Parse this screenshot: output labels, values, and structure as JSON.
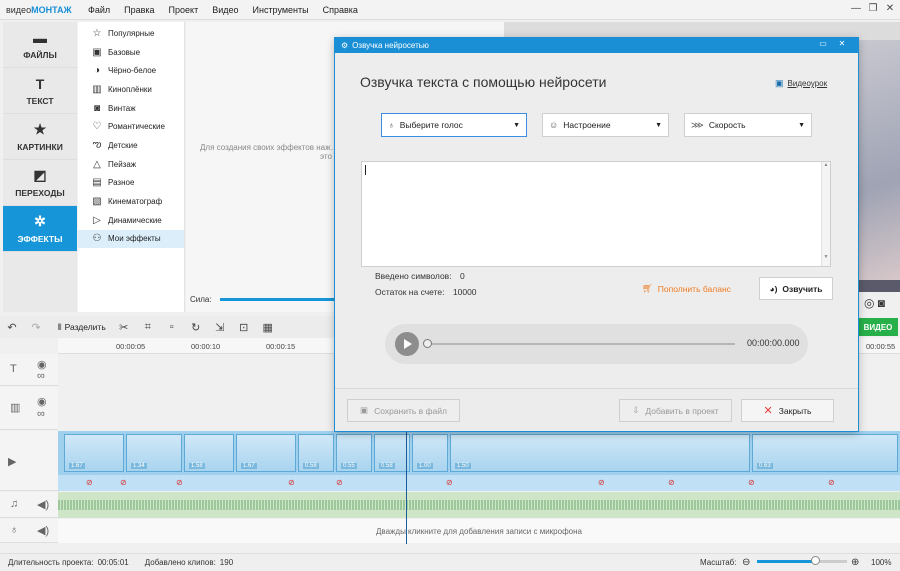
{
  "app": {
    "logo_plain": "видео",
    "logo_accent": "МОНТАЖ"
  },
  "menu": [
    "Файл",
    "Правка",
    "Проект",
    "Видео",
    "Инструменты",
    "Справка"
  ],
  "categories": [
    {
      "label": "ФАЙЛЫ",
      "icon": "folder-icon"
    },
    {
      "label": "ТЕКСТ",
      "icon": "text-icon"
    },
    {
      "label": "КАРТИНКИ",
      "icon": "star-icon"
    },
    {
      "label": "ПЕРЕХОДЫ",
      "icon": "transitions-icon"
    },
    {
      "label": "ЭФФЕКТЫ",
      "icon": "effects-icon"
    }
  ],
  "effects": [
    "Популярные",
    "Базовые",
    "Чёрно-белое",
    "Киноплёнки",
    "Винтаж",
    "Романтические",
    "Детские",
    "Пейзаж",
    "Разное",
    "Кинематограф",
    "Динамические",
    "Мои эффекты"
  ],
  "preview": {
    "hint": "Для создания своих эффектов наж…",
    "hint2": "это",
    "strength_label": "Сила:",
    "export_label": "ВИДЕО"
  },
  "toolbar": {
    "split_label": "Разделить"
  },
  "ruler": [
    "00:00:05",
    "00:00:10",
    "00:00:15",
    "00:00:55"
  ],
  "clip_labels": [
    "1.67",
    "1.34",
    "1.58",
    "1.67",
    "0.58",
    "0.55",
    "0.58",
    "1.00",
    "1.50",
    "0.63"
  ],
  "mic_hint": "Дважды кликните для добавления записи с микрофона",
  "status": {
    "duration_label": "Длительность проекта:",
    "duration": "00:05:01",
    "clips_label": "Добавлено клипов:",
    "clips": "190",
    "zoom_label": "Масштаб:",
    "zoom": "100%"
  },
  "dialog": {
    "window_title": "Озвучка нейросетью",
    "heading": "Озвучка текста с помощью нейросети",
    "tutorial": "Видеоурок",
    "voice_select": "Выберите голос",
    "mood_select": "Настроение",
    "speed_select": "Скорость",
    "chars_label": "Введено символов:",
    "chars_value": "0",
    "balance_label": "Остаток на счете:",
    "balance_value": "10000",
    "topup": "Пополнить баланс",
    "speak": "Озвучить",
    "time": "00:00:00.000",
    "save_file": "Сохранить в файл",
    "add_project": "Добавить в проект",
    "close": "Закрыть"
  }
}
